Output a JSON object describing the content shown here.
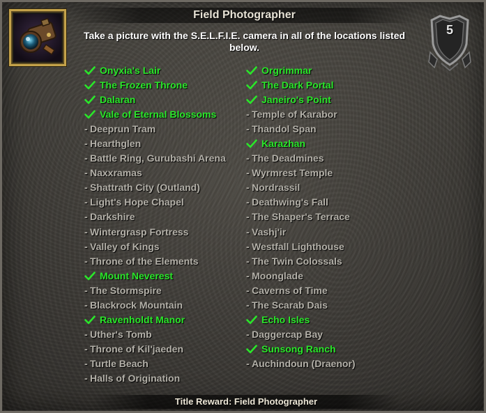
{
  "achievement": {
    "title": "Field Photographer",
    "description": "Take a picture with the S.E.L.F.I.E. camera in all of the locations listed below.",
    "points": "5",
    "reward": "Title Reward: Field Photographer",
    "icon": "selfie-camera-icon"
  },
  "colors": {
    "completed": "#2ae62a",
    "incomplete": "#b3b0a8",
    "title": "#e8e3d6",
    "icon_border": "#c4a24a"
  },
  "criteria_left": [
    {
      "label": "Onyxia's Lair",
      "completed": true
    },
    {
      "label": "The Frozen Throne",
      "completed": true
    },
    {
      "label": "Dalaran",
      "completed": true
    },
    {
      "label": "Vale of Eternal Blossoms",
      "completed": true
    },
    {
      "label": "Deeprun Tram",
      "completed": false
    },
    {
      "label": "Hearthglen",
      "completed": false
    },
    {
      "label": "Battle Ring, Gurubashi Arena",
      "completed": false
    },
    {
      "label": "Naxxramas",
      "completed": false
    },
    {
      "label": "Shattrath City (Outland)",
      "completed": false
    },
    {
      "label": "Light's Hope Chapel",
      "completed": false
    },
    {
      "label": "Darkshire",
      "completed": false
    },
    {
      "label": "Wintergrasp Fortress",
      "completed": false
    },
    {
      "label": "Valley of Kings",
      "completed": false
    },
    {
      "label": "Throne of the Elements",
      "completed": false
    },
    {
      "label": "Mount Neverest",
      "completed": true
    },
    {
      "label": "The Stormspire",
      "completed": false
    },
    {
      "label": "Blackrock Mountain",
      "completed": false
    },
    {
      "label": "Ravenholdt Manor",
      "completed": true
    },
    {
      "label": "Uther's Tomb",
      "completed": false
    },
    {
      "label": "Throne of Kil'jaeden",
      "completed": false
    },
    {
      "label": "Turtle Beach",
      "completed": false
    },
    {
      "label": "Halls of Origination",
      "completed": false
    }
  ],
  "criteria_right": [
    {
      "label": "Orgrimmar",
      "completed": true
    },
    {
      "label": "The Dark Portal",
      "completed": true
    },
    {
      "label": "Janeiro's Point",
      "completed": true
    },
    {
      "label": "Temple of Karabor",
      "completed": false
    },
    {
      "label": "Thandol Span",
      "completed": false
    },
    {
      "label": "Karazhan",
      "completed": true
    },
    {
      "label": "The Deadmines",
      "completed": false
    },
    {
      "label": "Wyrmrest Temple",
      "completed": false
    },
    {
      "label": "Nordrassil",
      "completed": false
    },
    {
      "label": "Deathwing's Fall",
      "completed": false
    },
    {
      "label": "The Shaper's Terrace",
      "completed": false
    },
    {
      "label": "Vashj'ir",
      "completed": false
    },
    {
      "label": "Westfall Lighthouse",
      "completed": false
    },
    {
      "label": "The Twin Colossals",
      "completed": false
    },
    {
      "label": "Moonglade",
      "completed": false
    },
    {
      "label": "Caverns of Time",
      "completed": false
    },
    {
      "label": "The Scarab Dais",
      "completed": false
    },
    {
      "label": "Echo Isles",
      "completed": true
    },
    {
      "label": "Daggercap Bay",
      "completed": false
    },
    {
      "label": "Sunsong Ranch",
      "completed": true
    },
    {
      "label": "Auchindoun (Draenor)",
      "completed": false
    }
  ]
}
